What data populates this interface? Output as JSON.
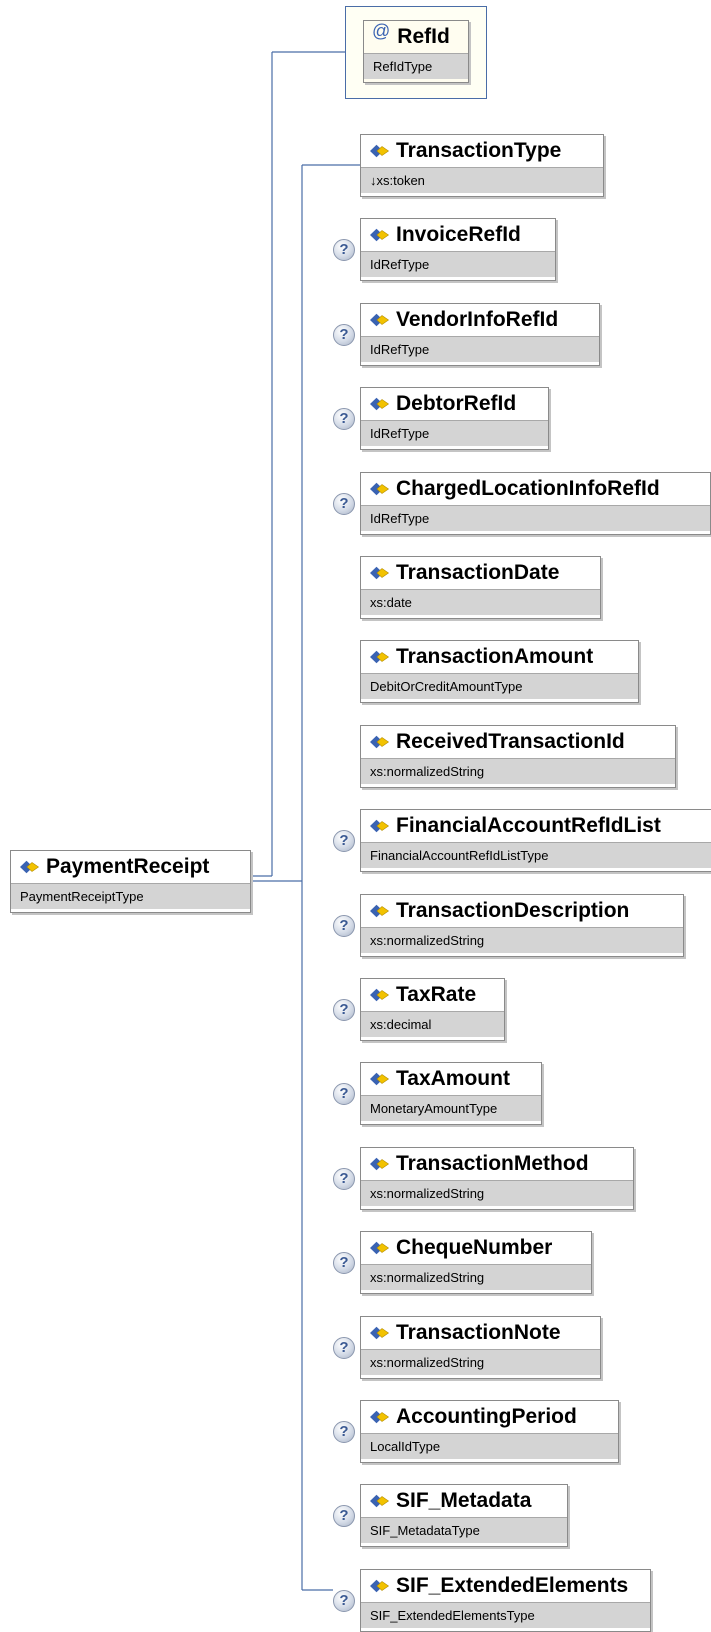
{
  "root": {
    "name": "PaymentReceipt",
    "type": "PaymentReceiptType"
  },
  "attribute": {
    "name": "RefId",
    "type": "RefIdType"
  },
  "children": [
    {
      "name": "TransactionType",
      "type": "↓xs:token",
      "optional": false
    },
    {
      "name": "InvoiceRefId",
      "type": "IdRefType",
      "optional": true
    },
    {
      "name": "VendorInfoRefId",
      "type": "IdRefType",
      "optional": true
    },
    {
      "name": "DebtorRefId",
      "type": "IdRefType",
      "optional": true
    },
    {
      "name": "ChargedLocationInfoRefId",
      "type": "IdRefType",
      "optional": true
    },
    {
      "name": "TransactionDate",
      "type": "xs:date",
      "optional": false
    },
    {
      "name": "TransactionAmount",
      "type": "DebitOrCreditAmountType",
      "optional": false
    },
    {
      "name": "ReceivedTransactionId",
      "type": "xs:normalizedString",
      "optional": false
    },
    {
      "name": "FinancialAccountRefIdList",
      "type": "FinancialAccountRefIdListType",
      "optional": true
    },
    {
      "name": "TransactionDescription",
      "type": "xs:normalizedString",
      "optional": true
    },
    {
      "name": "TaxRate",
      "type": "xs:decimal",
      "optional": true
    },
    {
      "name": "TaxAmount",
      "type": "MonetaryAmountType",
      "optional": true
    },
    {
      "name": "TransactionMethod",
      "type": "xs:normalizedString",
      "optional": true
    },
    {
      "name": "ChequeNumber",
      "type": "xs:normalizedString",
      "optional": true
    },
    {
      "name": "TransactionNote",
      "type": "xs:normalizedString",
      "optional": true
    },
    {
      "name": "AccountingPeriod",
      "type": "LocalIdType",
      "optional": true
    },
    {
      "name": "SIF_Metadata",
      "type": "SIF_MetadataType",
      "optional": true
    },
    {
      "name": "SIF_ExtendedElements",
      "type": "SIF_ExtendedElementsType",
      "optional": true
    }
  ],
  "optional_marker": "?",
  "attribute_marker": "@",
  "colors": {
    "connector": "#4a6da7",
    "type_band": "#d4d4d4",
    "attr_border": "#4a6da7",
    "icon_blue": "#3a63b2",
    "icon_yellow": "#f2c200"
  },
  "icons": {
    "element": "element-diamond-icon",
    "optional": "optional-question-icon",
    "attribute": "attribute-at-icon"
  }
}
